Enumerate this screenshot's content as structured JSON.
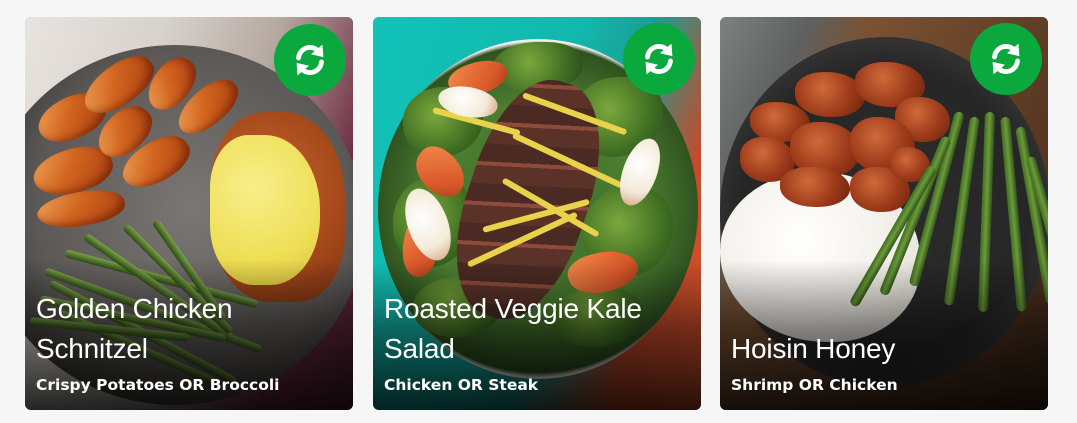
{
  "colors": {
    "page_background": "#f6f6f6",
    "swap_button": "#0aa83d",
    "text": "#ffffff"
  },
  "cards": [
    {
      "title": "Golden Chicken Schnitzel",
      "subtitle": "Crispy Potatoes OR Broccoli",
      "icon": "swap-icon"
    },
    {
      "title": "Roasted Veggie Kale Salad",
      "subtitle": "Chicken OR Steak",
      "icon": "swap-icon"
    },
    {
      "title": "Hoisin Honey",
      "subtitle": "Shrimp OR Chicken",
      "icon": "swap-icon"
    }
  ]
}
